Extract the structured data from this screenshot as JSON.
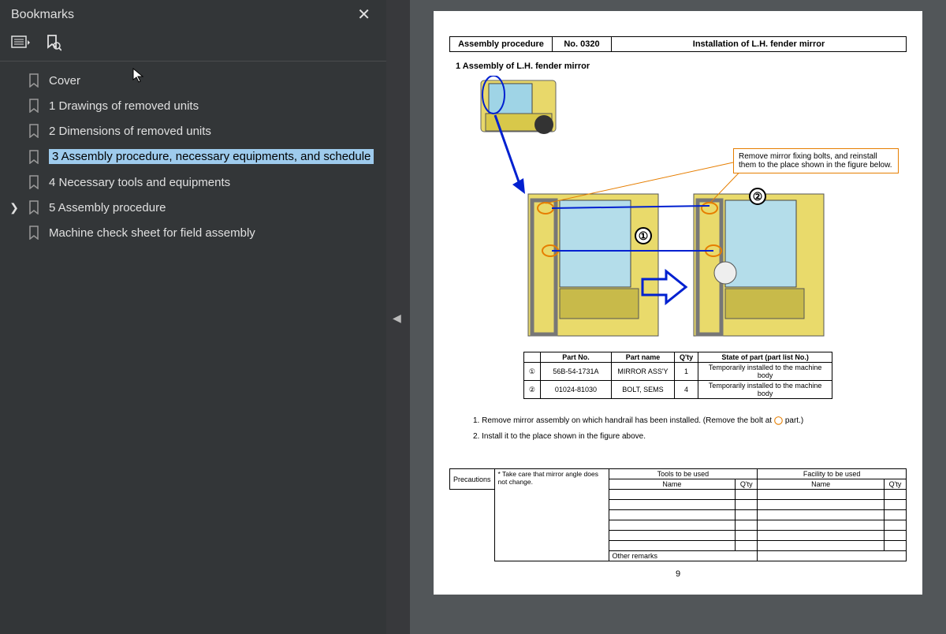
{
  "sidebar": {
    "title": "Bookmarks",
    "items": [
      {
        "label": "Cover"
      },
      {
        "label": "1 Drawings of removed units"
      },
      {
        "label": "2 Dimensions of removed units"
      },
      {
        "label": "3 Assembly procedure, necessary equipments, and schedule",
        "selected": true
      },
      {
        "label": "4 Necessary tools and equipments"
      },
      {
        "label": "5 Assembly procedure",
        "expandable": true
      },
      {
        "label": "Machine check sheet for field assembly"
      }
    ]
  },
  "doc": {
    "header": {
      "col1": "Assembly procedure",
      "col2_label": "No.",
      "col2_val": "0320",
      "col3": "Installation of L.H. fender mirror"
    },
    "section_num": "1",
    "section_title": "Assembly of L.H. fender mirror",
    "note": "Remove mirror fixing bolts, and reinstall them to the place shown in the figure below.",
    "parts": {
      "headers": [
        "",
        "Part No.",
        "Part name",
        "Q'ty",
        "State of part (part list No.)"
      ],
      "rows": [
        [
          "①",
          "56B-54-1731A",
          "MIRROR ASS'Y",
          "1",
          "Temporarily installed to the machine body"
        ],
        [
          "②",
          "01024-81030",
          "BOLT, SEMS",
          "4",
          "Temporarily installed to the machine body"
        ]
      ]
    },
    "steps": [
      "1. Remove mirror assembly on which handrail has been installed. (Remove the bolt at",
      " part.)",
      "2. Install it to the place shown in the figure above."
    ],
    "precautions_label": "Precautions",
    "precaution_text": "* Take care that mirror angle does not change.",
    "tools_label": "Tools to be used",
    "facility_label": "Facility to be used",
    "name_label": "Name",
    "qty_label": "Q'ty",
    "other_remarks": "Other remarks",
    "page_num": "9"
  }
}
